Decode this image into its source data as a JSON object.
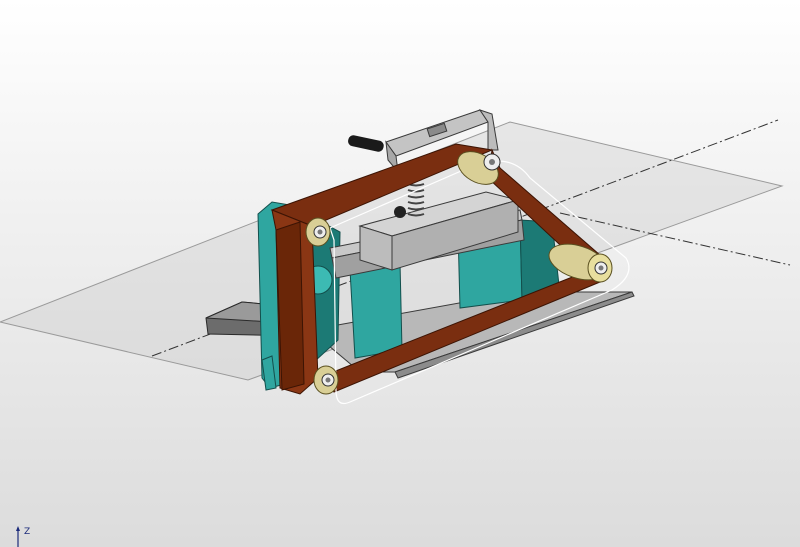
{
  "viewport": {
    "axis_triad": {
      "z_label": "Z"
    }
  },
  "colors": {
    "belt": "#7a2e10",
    "belt_edge": "#3c1404",
    "frame_teal": "#2fa6a0",
    "frame_teal_dark": "#1c7a75",
    "metal_light": "#d0d0d0",
    "metal_mid": "#a8a8a8",
    "metal_dark": "#5a5a5a",
    "roller_brass": "#d9cf96",
    "reference_plane": "#c9c9c9",
    "axis_line": "#333333",
    "axis_triad": "#1a2a7a"
  },
  "icons": {
    "axis_triad": "xyz-axis-triad-icon"
  }
}
